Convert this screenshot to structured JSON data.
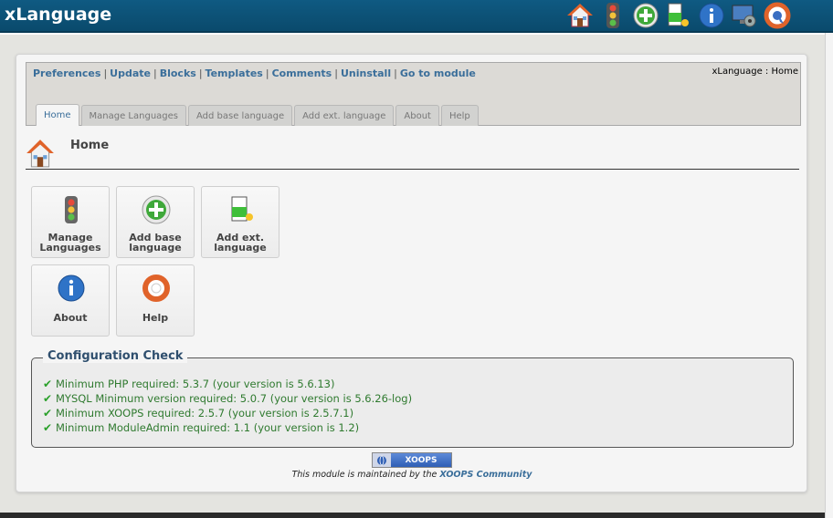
{
  "header": {
    "title": "xLanguage",
    "icons": [
      "home-icon",
      "traffic-light-icon",
      "add-icon",
      "add-language-icon",
      "info-icon",
      "settings-icon",
      "help-icon"
    ]
  },
  "nav": {
    "links": [
      "Preferences",
      "Update",
      "Blocks",
      "Templates",
      "Comments",
      "Uninstall",
      "Go to module"
    ],
    "breadcrumb": "xLanguage : Home"
  },
  "tabs": [
    "Home",
    "Manage Languages",
    "Add base language",
    "Add ext. language",
    "About",
    "Help"
  ],
  "active_tab": "Home",
  "page": {
    "title": "Home"
  },
  "tiles": [
    {
      "line1": "Manage",
      "line2": "Languages",
      "icon": "traffic-light-icon"
    },
    {
      "line1": "Add base",
      "line2": "language",
      "icon": "add-icon"
    },
    {
      "line1": "Add ext.",
      "line2": "language",
      "icon": "add-language-icon"
    },
    {
      "line1": "About",
      "line2": "",
      "icon": "info-icon"
    },
    {
      "line1": "Help",
      "line2": "",
      "icon": "help-icon"
    }
  ],
  "config": {
    "legend": "Configuration Check",
    "items": [
      "Minimum PHP required: 5.3.7 (your version is 5.6.13)",
      "MYSQL Minimum version required: 5.0.7 (your version is 5.6.26-log)",
      "Minimum XOOPS required: 2.5.7 (your version is 2.5.7.1)",
      "Minimum ModuleAdmin required: 1.1 (your version is 1.2)"
    ]
  },
  "footer": {
    "badge": "XOOPS",
    "note_prefix": "This module is maintained by the ",
    "note_link": "XOOPS Community"
  },
  "colors": {
    "header_bg": "#0f5a82",
    "link": "#3a6e9a",
    "ok_green": "#2f7a2f"
  }
}
